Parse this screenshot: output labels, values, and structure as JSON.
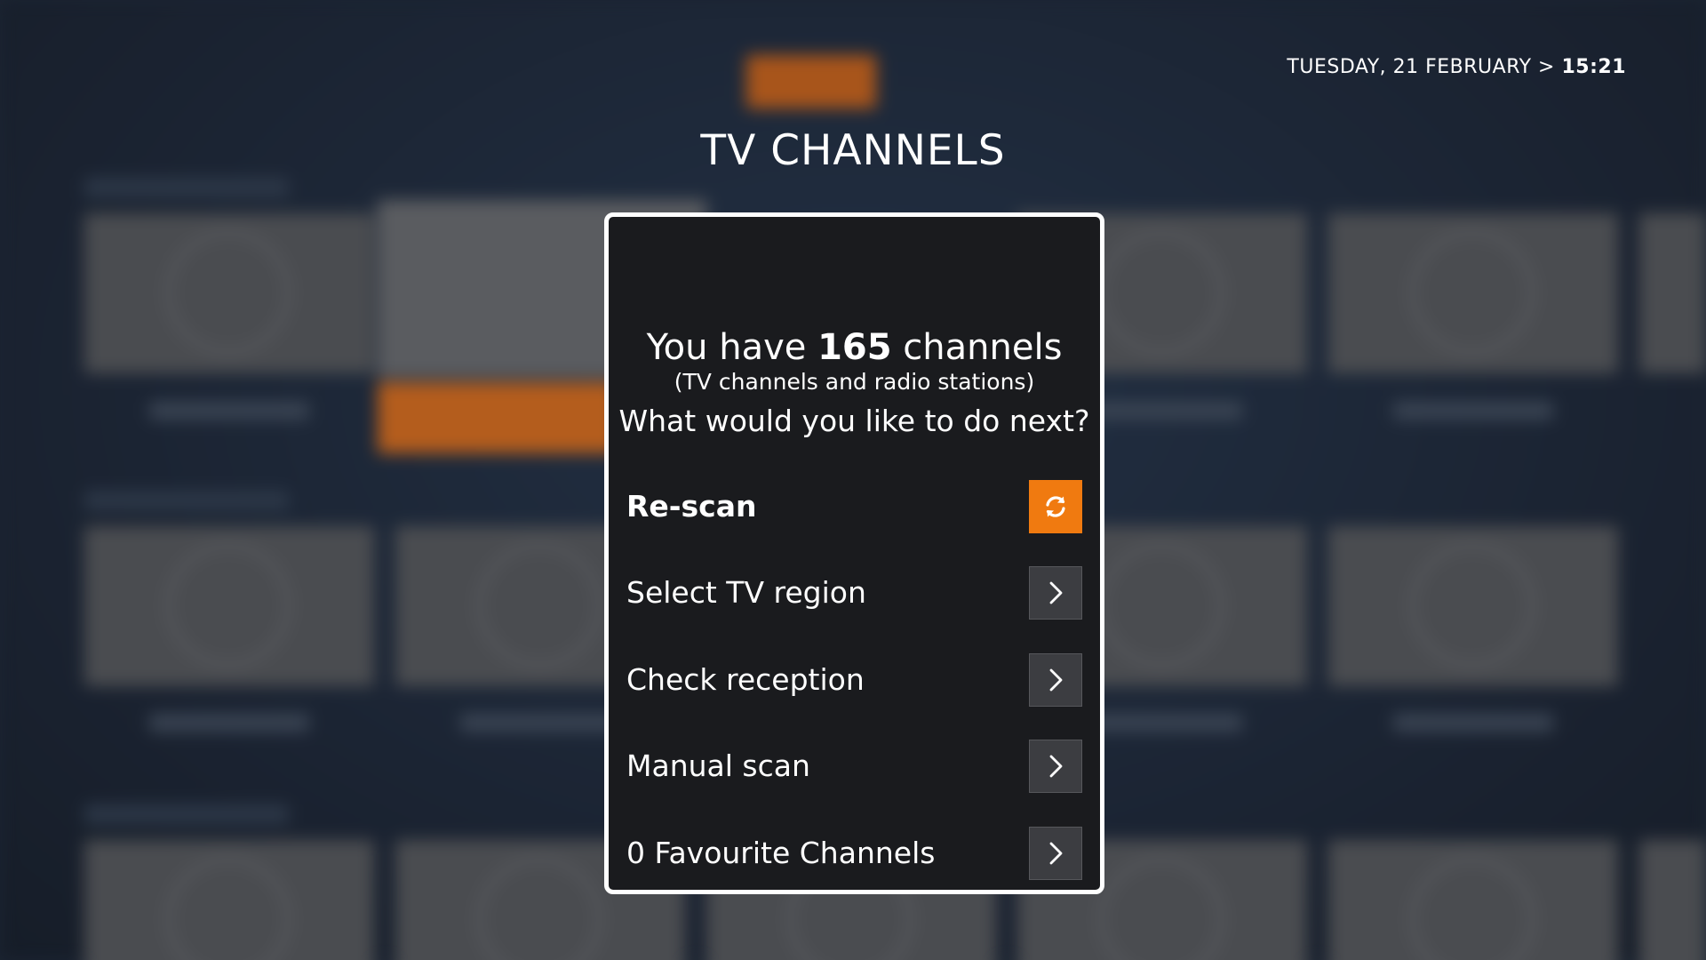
{
  "header": {
    "date": "TUESDAY, 21 FEBRUARY",
    "separator": ">",
    "time": "15:21",
    "title": "TV CHANNELS"
  },
  "dialog": {
    "summary": {
      "prefix": "You have ",
      "channel_count": "165",
      "suffix": " channels",
      "subtitle": "(TV channels and radio stations)",
      "question": "What would you like to do next?"
    },
    "options": [
      {
        "label": "Re-scan",
        "icon": "refresh-icon",
        "selected": true
      },
      {
        "label": "Select TV region",
        "icon": "chevron-right-icon",
        "selected": false
      },
      {
        "label": "Check reception",
        "icon": "chevron-right-icon",
        "selected": false
      },
      {
        "label": "Manual scan",
        "icon": "chevron-right-icon",
        "selected": false
      },
      {
        "label": "0 Favourite Channels",
        "icon": "chevron-right-icon",
        "selected": false
      }
    ]
  },
  "colors": {
    "accent": "#f07a10",
    "dialog_bg": "#1a1b1e",
    "page_bg": "#1b2432"
  }
}
